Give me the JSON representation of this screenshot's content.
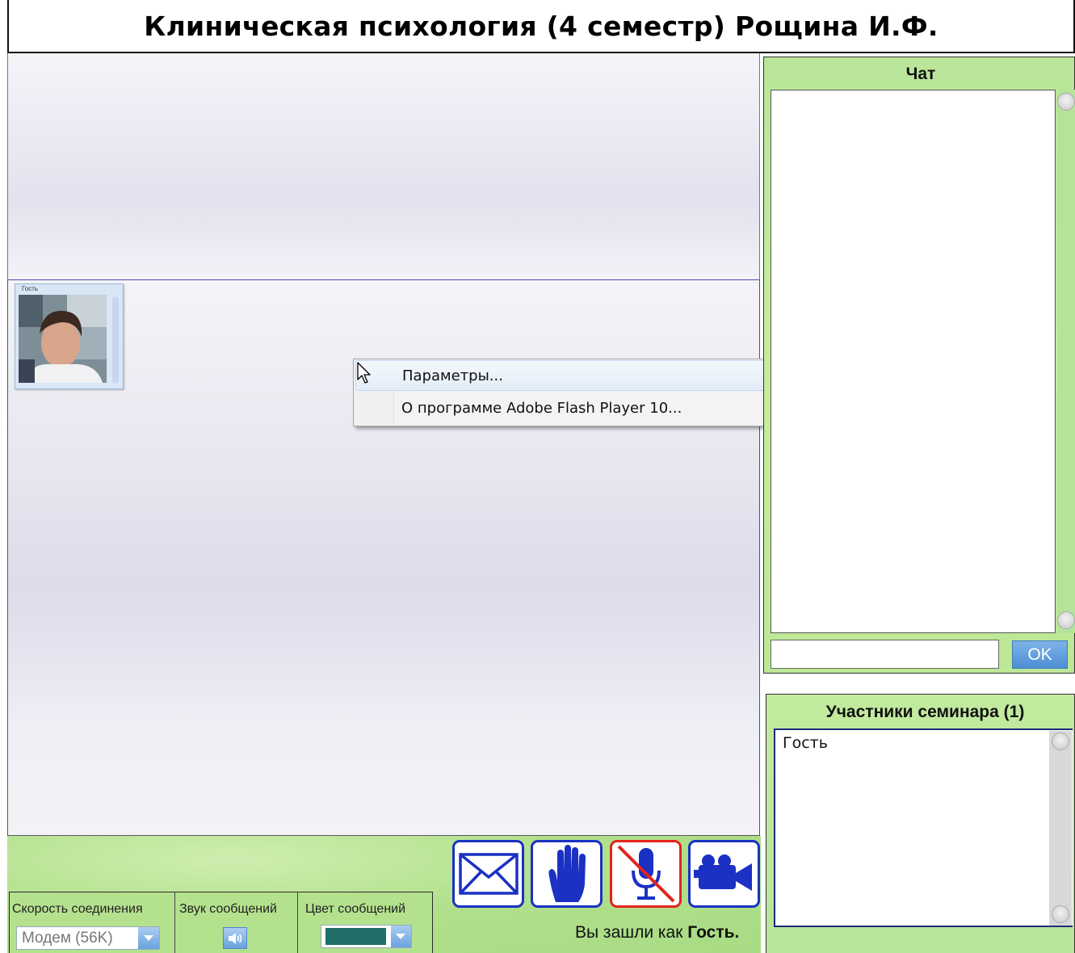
{
  "title": "Клиническая психология (4 семестр) Рощина И.Ф.",
  "webcam": {
    "user_label": "Гость"
  },
  "context_menu": {
    "items": [
      {
        "label": "Параметры..."
      },
      {
        "label": "О программе Adobe Flash Player 10..."
      }
    ]
  },
  "chat": {
    "title": "Чат",
    "input_value": "",
    "ok_label": "OK"
  },
  "participants": {
    "title": "Участники семинара (1)",
    "list": [
      "Гость"
    ]
  },
  "settings": {
    "speed_label": "Скорость соединения",
    "speed_value": "Модем (56K)",
    "sound_label": "Звук сообщений",
    "color_label": "Цвет сообщений",
    "color_value": "#1f6e6a"
  },
  "toolbar": {
    "buttons": [
      {
        "icon": "envelope-icon"
      },
      {
        "icon": "raise-hand-icon"
      },
      {
        "icon": "microphone-muted-icon",
        "state": "disabled"
      },
      {
        "icon": "video-camera-icon"
      }
    ]
  },
  "status": {
    "prefix": "Вы зашли как ",
    "user": "Гость."
  },
  "colors": {
    "accent_blue": "#1a31c4",
    "panel_green": "#b8e69a",
    "mute_red": "#e3231c"
  }
}
